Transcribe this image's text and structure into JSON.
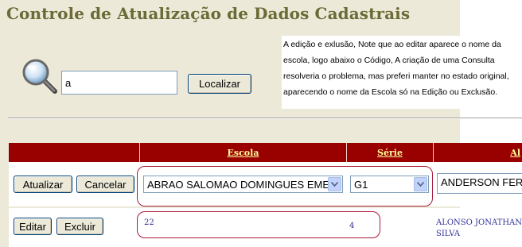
{
  "header": {
    "title": "Controle de Atualização de Dados Cadastrais"
  },
  "note": {
    "lines": [
      "A edição e exlusão, Note que ao editar aparece o nome da",
      "escola,  logo abaixo o Código,  A criação de uma Consulta",
      "resolveria o problema, mas preferi manter no estado original,",
      "aparecendo o nome da Escola só na Edição ou Exclusão."
    ]
  },
  "search": {
    "value": "a",
    "button_label": "Localizar",
    "icon": "magnifier-icon"
  },
  "grid": {
    "columns": [
      "Escola",
      "Série",
      "Al"
    ],
    "edit_row": {
      "update_label": "Atualizar",
      "cancel_label": "Cancelar",
      "escola_selected": "ABRAO SALOMAO DOMINGUES EMEF",
      "serie_selected": "G1",
      "aluno_value": "ANDERSON FERREIRA"
    },
    "rows": [
      {
        "edit_label": "Editar",
        "delete_label": "Excluir",
        "escola": "22",
        "serie": "4",
        "aluno_line1": "ALONSO JONATHAN",
        "aluno_line2": "SILVA"
      }
    ]
  },
  "colors": {
    "header_bg": "#990000",
    "header_text": "#ffff99",
    "panel_bg": "#ece9d8",
    "title": "#6b6b37",
    "highlight": "#aa1a3a",
    "link": "#333399"
  }
}
